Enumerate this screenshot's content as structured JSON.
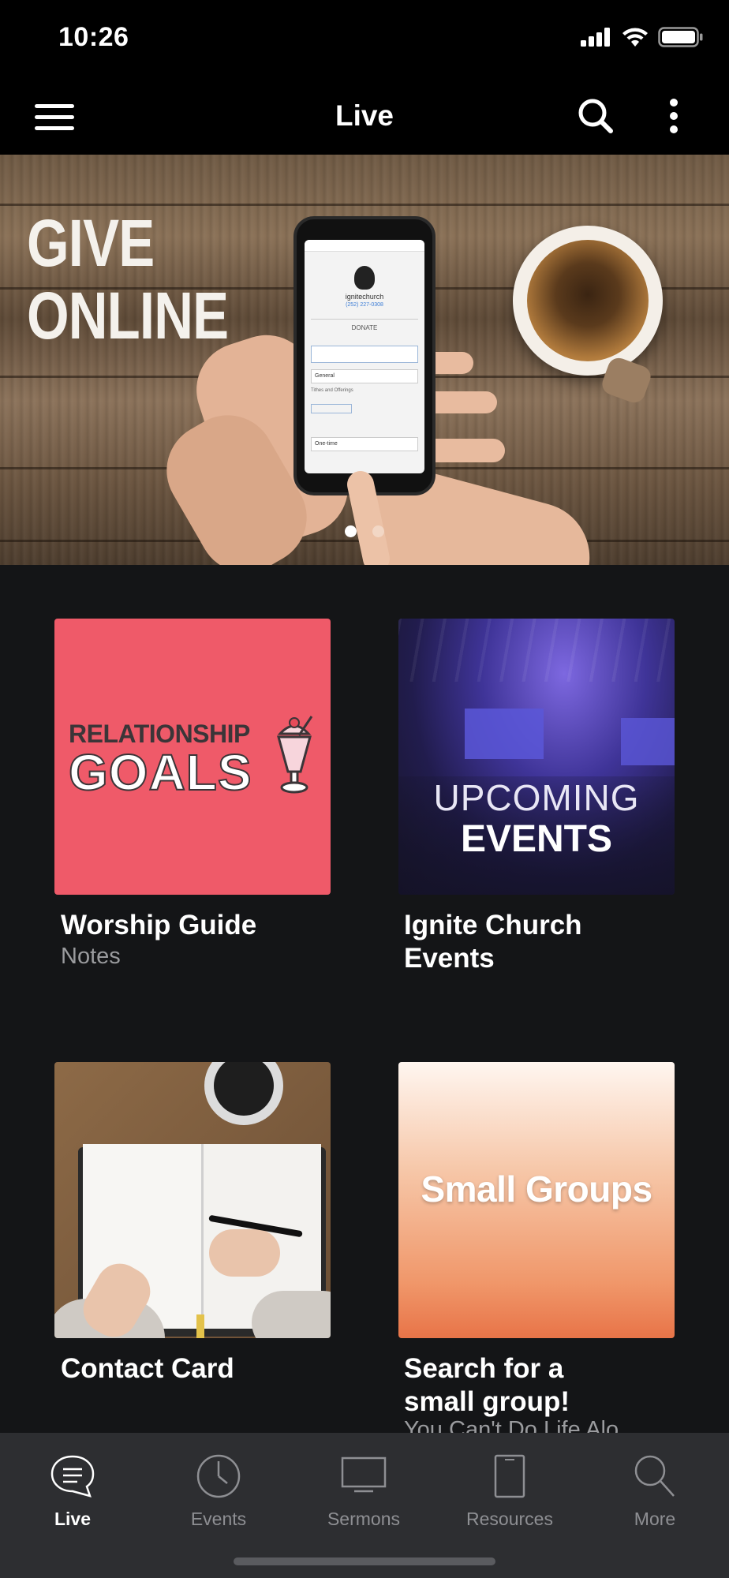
{
  "status_bar": {
    "time": "10:26"
  },
  "nav": {
    "title": "Live"
  },
  "hero": {
    "title_line1": "GIVE",
    "title_line2": "ONLINE",
    "phone_app": "ignitechurch",
    "phone_phone": "(252) 227-0308",
    "phone_donate": "DONATE",
    "phone_fund": "General",
    "phone_fund_desc": "Tithes and Offerings",
    "phone_frequency": "One-time",
    "carousel_count": 2,
    "carousel_active": 1
  },
  "tiles": [
    {
      "image_line1": "RELATIONSHIP",
      "image_line2": "GOALS",
      "title": "Worship Guide",
      "subtitle": "Notes"
    },
    {
      "image_line1": "UPCOMING",
      "image_line2": "EVENTS",
      "title_line1": "Ignite Church",
      "title_line2": "Events"
    },
    {
      "title": "Contact Card"
    },
    {
      "image_text": "Small Groups",
      "title_line1": "Search for a",
      "title_line2": "small group!",
      "subtitle": "You Can't Do Life Alo"
    }
  ],
  "tabbar": {
    "items": [
      {
        "label": "Live",
        "icon": "chat-bubble-icon",
        "active": true
      },
      {
        "label": "Events",
        "icon": "clock-icon",
        "active": false
      },
      {
        "label": "Sermons",
        "icon": "tv-icon",
        "active": false
      },
      {
        "label": "Resources",
        "icon": "tablet-icon",
        "active": false
      },
      {
        "label": "More",
        "icon": "search-icon",
        "active": false
      }
    ]
  },
  "colors": {
    "background": "#141517",
    "tabbar": "#2d2e31",
    "tab_inactive": "#8e8f93",
    "relationship_tile": "#ef5a69",
    "subtitle": "#9a9b9e"
  }
}
